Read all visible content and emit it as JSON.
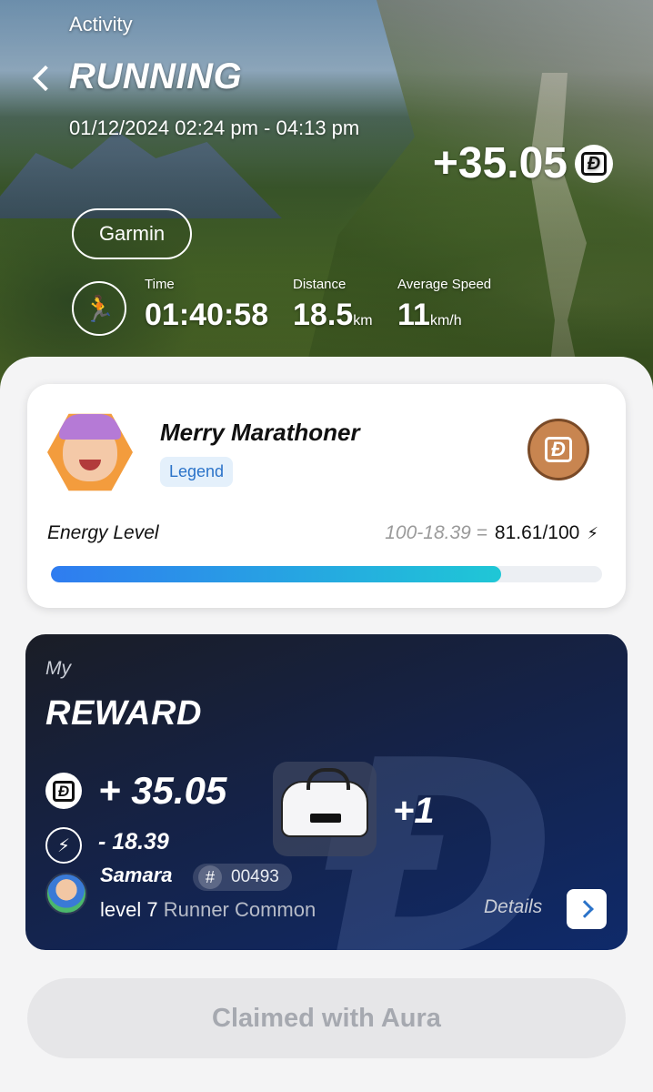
{
  "header": {
    "section_label": "Activity",
    "title": "RUNNING",
    "datetime": "01/12/2024 02:24 pm - 04:13 pm",
    "earned": "+35.05",
    "source": "Garmin"
  },
  "stats": [
    {
      "label": "Time",
      "value": "01:40:58",
      "unit": ""
    },
    {
      "label": "Distance",
      "value": "18.5",
      "unit": "km"
    },
    {
      "label": "Average Speed",
      "value": "11",
      "unit": "km/h"
    }
  ],
  "profile": {
    "name": "Merry Marathoner",
    "badge": "Legend",
    "energy_label": "Energy Level",
    "energy_calc": "100-18.39 =",
    "energy_value": "81.61/100",
    "energy_fraction": 0.8161
  },
  "reward": {
    "my_label": "My",
    "title": "REWARD",
    "plus": "+ 35.05",
    "minus": "- 18.39",
    "item_count": "+1",
    "runner_name": "Samara",
    "serial": "00493",
    "level": "level 7",
    "runner_type": "Runner Common",
    "details_label": "Details"
  },
  "claim_button": "Claimed with Aura",
  "colors": {
    "accent_blue": "#2b73c9",
    "energy_start": "#2f7cf0",
    "energy_end": "#1fc7d6",
    "reward_bg": "#152246"
  },
  "icons": {
    "back": "chevron-left-icon",
    "coin": "defit-coin-icon",
    "run": "runner-icon",
    "bolt": "lightning-icon",
    "details": "chevron-right-icon"
  }
}
